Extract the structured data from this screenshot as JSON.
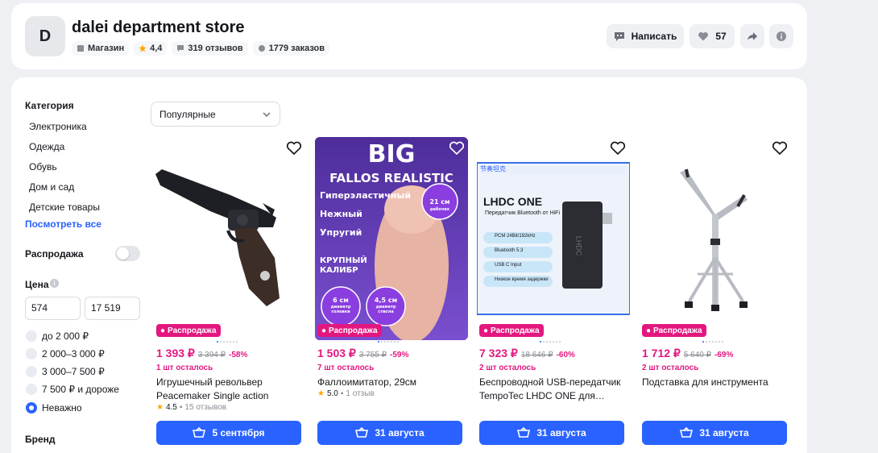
{
  "store": {
    "logo_letter": "D",
    "name": "dalei department store",
    "type": "Магазин",
    "rating": "4,4",
    "reviews": "319 отзывов",
    "orders": "1779 заказов"
  },
  "header_actions": {
    "write_label": "Написать",
    "likes": "57"
  },
  "sidebar": {
    "category_title": "Категория",
    "categories": [
      "Электроника",
      "Одежда",
      "Обувь",
      "Дом и сад",
      "Детские товары"
    ],
    "see_all": "Посмотреть все",
    "sale_label": "Распродажа",
    "price_title": "Цена",
    "price_from": "574",
    "price_to": "17 519",
    "price_ranges": [
      "до 2 000 ₽",
      "2 000–3 000 ₽",
      "3 000–7 500 ₽",
      "7 500 ₽ и дороже",
      "Неважно"
    ],
    "brand_title": "Бренд"
  },
  "sort": {
    "selected": "Популярные"
  },
  "colors": {
    "accent": "#2962ff",
    "sale": "#e3177f"
  },
  "products": [
    {
      "badge": "Распродажа",
      "price": "1 393 ₽",
      "old_price": "3 394 ₽",
      "discount": "-58%",
      "stock": "1 шт осталось",
      "title": "Игрушечный револьвер Peacemaker Single action",
      "rating": "4.5",
      "reviews": "15 отзывов",
      "delivery": "5 сентября"
    },
    {
      "badge": "Распродажа",
      "price": "1 503 ₽",
      "old_price": "3 755 ₽",
      "discount": "-59%",
      "stock": "7 шт осталось",
      "title": "Фаллоимитатор, 29см",
      "rating": "5.0",
      "reviews": "1 отзыв",
      "delivery": "31 августа",
      "image_text": {
        "big": "BIG",
        "line1": "FALLOS REALISTIC",
        "w1": "Гиперэластичный",
        "w2": "Нежный",
        "w3": "Упругий",
        "caliber": "КРУПНЫЙ КАЛИБР",
        "size_a": "21 см",
        "size_a_sub": "рабочих",
        "size_b": "6 см",
        "size_b_sub": "диаметр головки",
        "size_c": "4,5 см",
        "size_c_sub": "диаметр ствола"
      }
    },
    {
      "badge": "Распродажа",
      "price": "7 323 ₽",
      "old_price": "18 646 ₽",
      "discount": "-60%",
      "stock": "2 шт осталось",
      "title": "Беспроводной USB-передатчик TempoTec LHDC ONE для…",
      "delivery": "31 августа",
      "image_text": {
        "brand": "节奏坦克",
        "model": "LHDC ONE",
        "sub": "Передатчик Bluetooth от HiFi",
        "f1": "PCM 24Bit/192kHz",
        "f2": "Bluetooth 5.3",
        "f3": "USB C Input",
        "f4": "Низкое время задержки",
        "device": "LHDC"
      }
    },
    {
      "badge": "Распродажа",
      "price": "1 712 ₽",
      "old_price": "5 640 ₽",
      "discount": "-69%",
      "stock": "2 шт осталось",
      "title": "Подставка для инструмента",
      "delivery": "31 августа"
    }
  ]
}
